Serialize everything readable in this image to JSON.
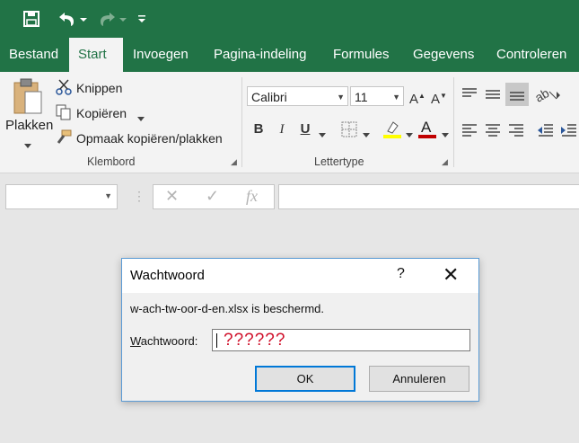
{
  "qat": {
    "save_icon": "save-icon",
    "undo_icon": "undo-icon",
    "redo_icon": "redo-icon",
    "customize_icon": "customize-qat-icon"
  },
  "tabs": [
    "Bestand",
    "Start",
    "Invoegen",
    "Pagina-indeling",
    "Formules",
    "Gegevens",
    "Controleren"
  ],
  "active_tab": "Start",
  "ribbon": {
    "clipboard": {
      "paste_label": "Plakken",
      "cut_label": "Knippen",
      "copy_label": "Kopiëren",
      "format_painter_label": "Opmaak kopiëren/plakken",
      "group_label": "Klembord"
    },
    "font": {
      "font_name": "Calibri",
      "font_size": "11",
      "bold": "B",
      "italic": "I",
      "underline": "U",
      "group_label": "Lettertype",
      "highlight_color": "#ffff00",
      "font_color": "#c00000"
    }
  },
  "formula_bar": {
    "cancel_glyph": "✕",
    "enter_glyph": "✓",
    "fx_glyph": "fx"
  },
  "dialog": {
    "title": "Wachtwoord",
    "help": "?",
    "close": "✕",
    "message": "w-ach-tw-oor-d-en.xlsx is beschermd.",
    "label_underlined": "W",
    "label_rest": "achtwoord:",
    "password_value": "??????",
    "ok_label": "OK",
    "cancel_label": "Annuleren"
  },
  "colors": {
    "brand": "#217346",
    "dialog_border": "#5b9bd5",
    "default_button_border": "#0078d7"
  }
}
